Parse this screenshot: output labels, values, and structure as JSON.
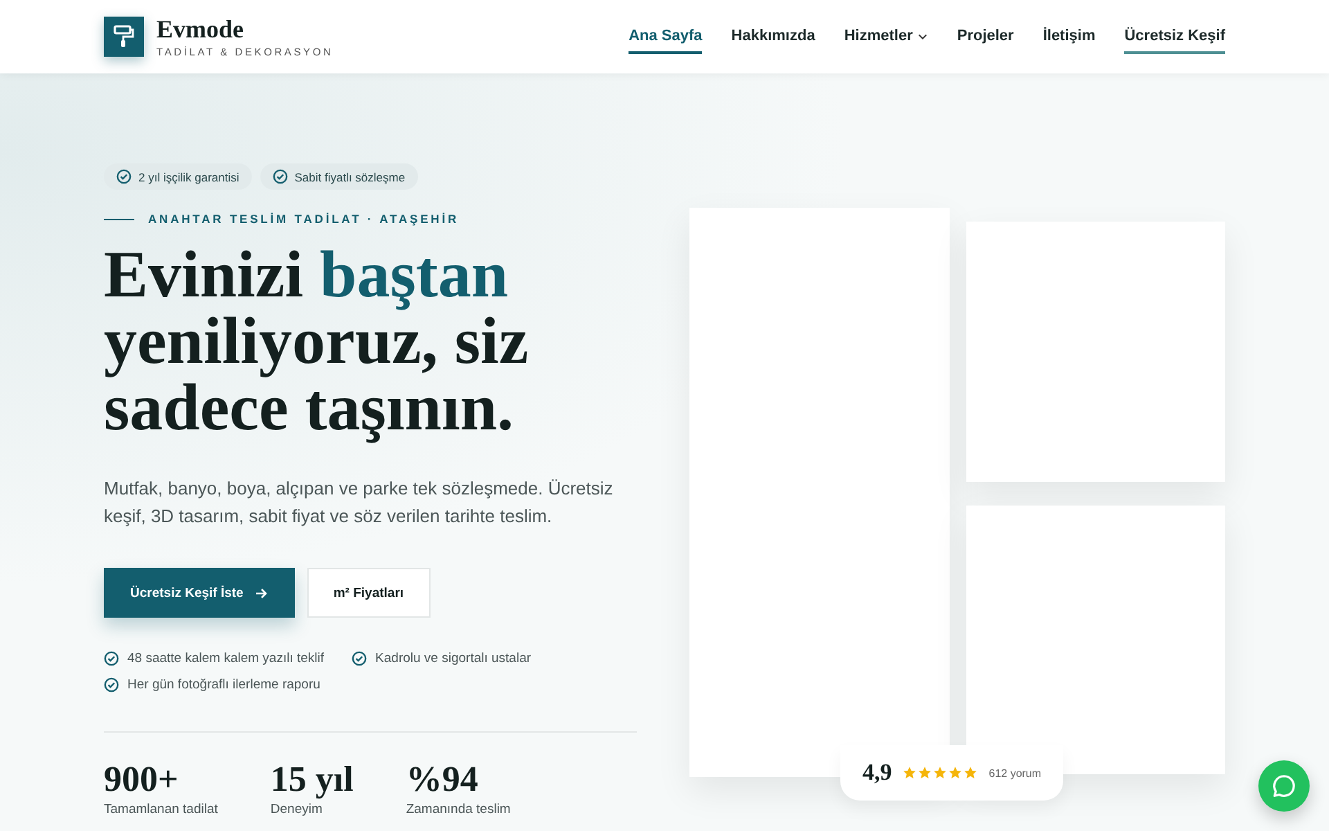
{
  "brand": {
    "name": "Evmode",
    "tagline": "TADİLAT & DEKORASYON"
  },
  "nav": [
    {
      "label": "Ana Sayfa",
      "selected": true,
      "kind": "link",
      "has_menu": false
    },
    {
      "label": "Hakkımızda",
      "selected": false,
      "kind": "link",
      "has_menu": false
    },
    {
      "label": "Hizmetler",
      "selected": false,
      "kind": "link",
      "has_menu": true
    },
    {
      "label": "Projeler",
      "selected": false,
      "kind": "link",
      "has_menu": false
    },
    {
      "label": "İletişim",
      "selected": false,
      "kind": "link",
      "has_menu": false
    },
    {
      "label": "Ücretsiz Keşif",
      "selected": false,
      "kind": "cta",
      "has_menu": false
    }
  ],
  "hero": {
    "badges": [
      "2 yıl işçilik garantisi",
      "Sabit fiyatlı sözleşme"
    ],
    "eyebrow": "ANAHTAR TESLİM TADİLAT · ATAŞEHİR",
    "title_start": "Evinizi",
    "title_highlight": "baştan",
    "title_end": "yeniliyoruz, siz sadece taşının.",
    "lead": "Mutfak, banyo, boya, alçıpan ve parke tek sözleşmede. Ücretsiz keşif, 3D tasarım, sabit fiyat ve söz verilen tarihte teslim.",
    "buttons": [
      {
        "label": "Ücretsiz Keşif İste",
        "kind": "primary"
      },
      {
        "label": "m² Fiyatları",
        "kind": "secondary"
      }
    ],
    "features": [
      "48 saatte kalem kalem yazılı teklif",
      "Kadrolu ve sigortalı ustalar",
      "Her gün fotoğraflı ilerleme raporu"
    ],
    "stats": [
      {
        "value": "900+",
        "label": "Tamamlanan tadilat"
      },
      {
        "value": "15 yıl",
        "label": "Deneyim"
      },
      {
        "value": "%94",
        "label": "Zamanında teslim"
      }
    ]
  },
  "rating": {
    "score": "4,9",
    "stars": 5,
    "reviews": "612 yorum"
  }
}
